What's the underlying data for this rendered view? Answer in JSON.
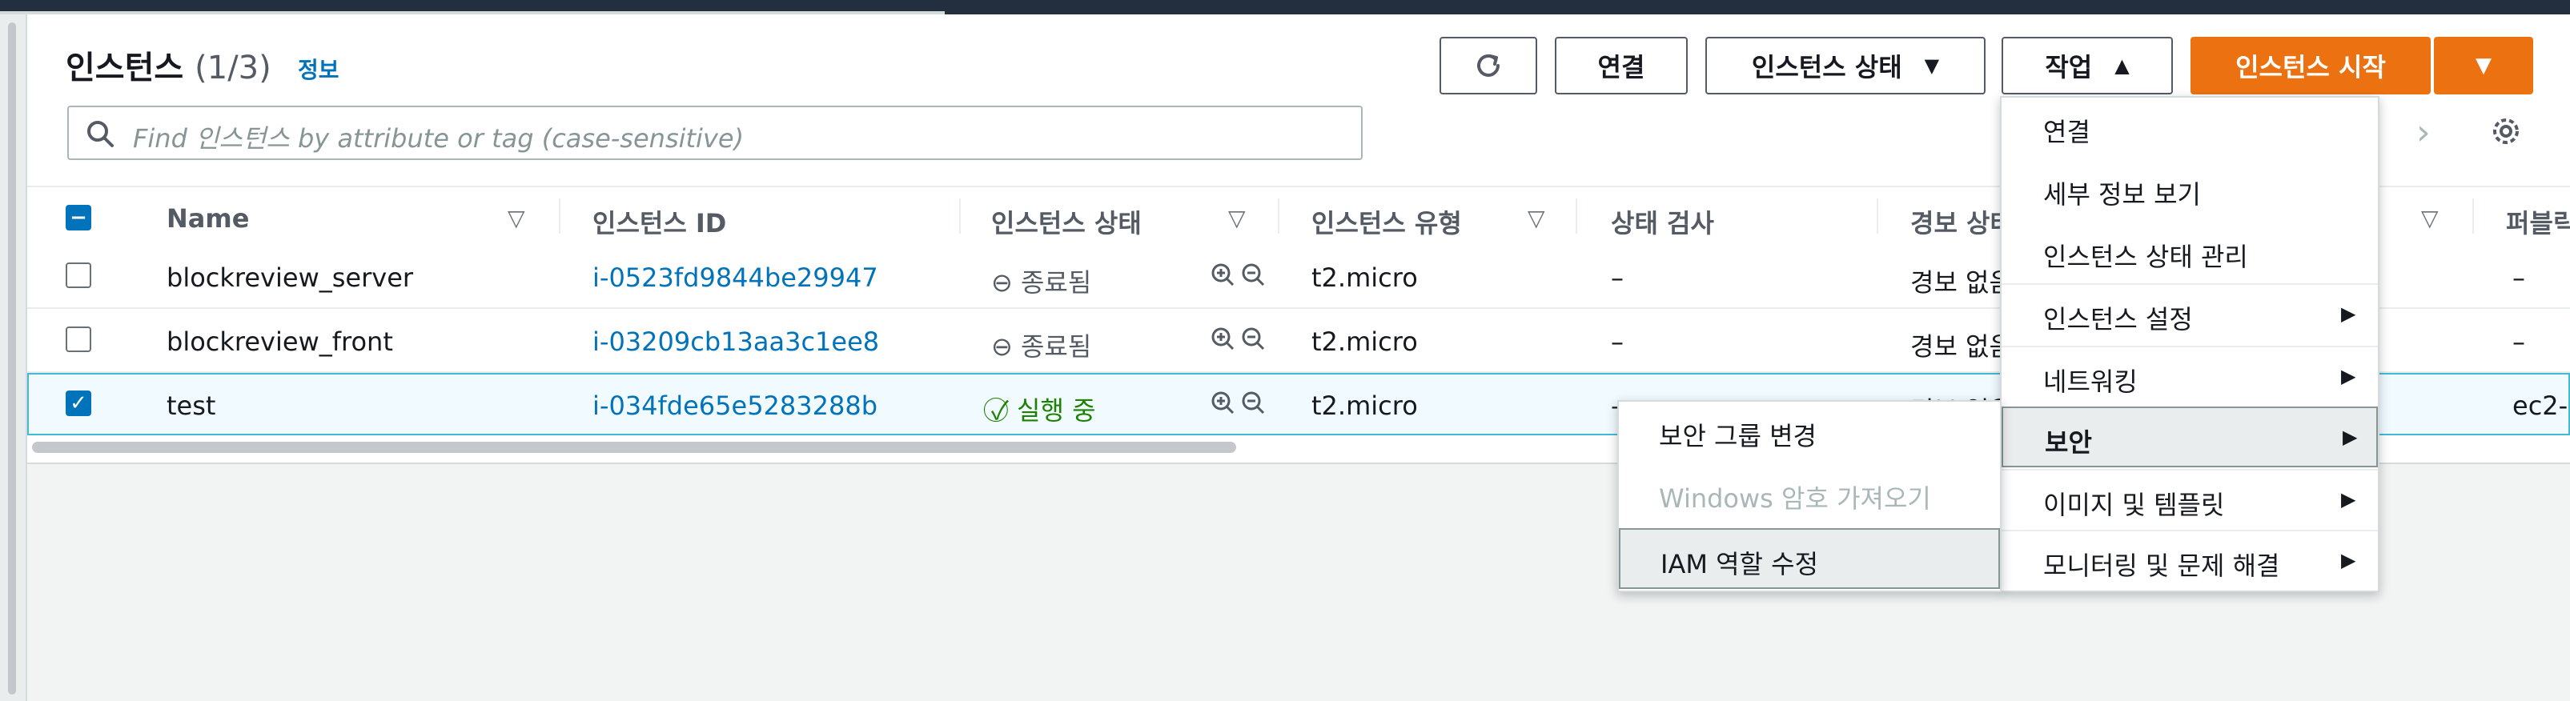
{
  "header": {
    "title": "인스턴스",
    "count": "(1/3)",
    "info_link": "정보"
  },
  "toolbar": {
    "refresh_icon": "refresh-icon",
    "connect_label": "연결",
    "instance_state_label": "인스턴스 상태",
    "actions_label": "작업",
    "launch_label": "인스턴스 시작",
    "primary_color": "#ec7211"
  },
  "search": {
    "placeholder": "Find 인스턴스 by attribute or tag (case-sensitive)"
  },
  "table": {
    "columns": [
      "Name",
      "인스턴스 ID",
      "인스턴스 상태",
      "인스턴스 유형",
      "상태 검사",
      "경보 상태",
      "퍼블릭"
    ],
    "rows": [
      {
        "name": "blockreview_server",
        "id": "i-0523fd9844be29947",
        "state": "종료됨",
        "type": "t2.micro",
        "check": "–",
        "alarm": "경보 없음",
        "public": "–",
        "selected": false
      },
      {
        "name": "blockreview_front",
        "id": "i-03209cb13aa3c1ee8",
        "state": "종료됨",
        "type": "t2.micro",
        "check": "–",
        "alarm": "경보 없음",
        "public": "–",
        "selected": false
      },
      {
        "name": "test",
        "id": "i-034fde65e5283288b",
        "state": "실행 중",
        "type": "t2.micro",
        "check": "–",
        "alarm": "경보 없음",
        "public": "ec2-",
        "selected": true
      }
    ]
  },
  "actions_menu": {
    "items": [
      {
        "label": "연결"
      },
      {
        "label": "세부 정보 보기"
      },
      {
        "label": "인스턴스 상태 관리"
      },
      {
        "label": "인스턴스 설정"
      },
      {
        "label": "네트워킹"
      },
      {
        "label": "보안"
      },
      {
        "label": "이미지 및 템플릿"
      },
      {
        "label": "모니터링 및 문제 해결"
      }
    ]
  },
  "security_submenu": {
    "items": [
      {
        "label": "보안 그룹 변경"
      },
      {
        "label": "Windows 암호 가져오기"
      },
      {
        "label": "IAM 역할 수정"
      }
    ]
  }
}
